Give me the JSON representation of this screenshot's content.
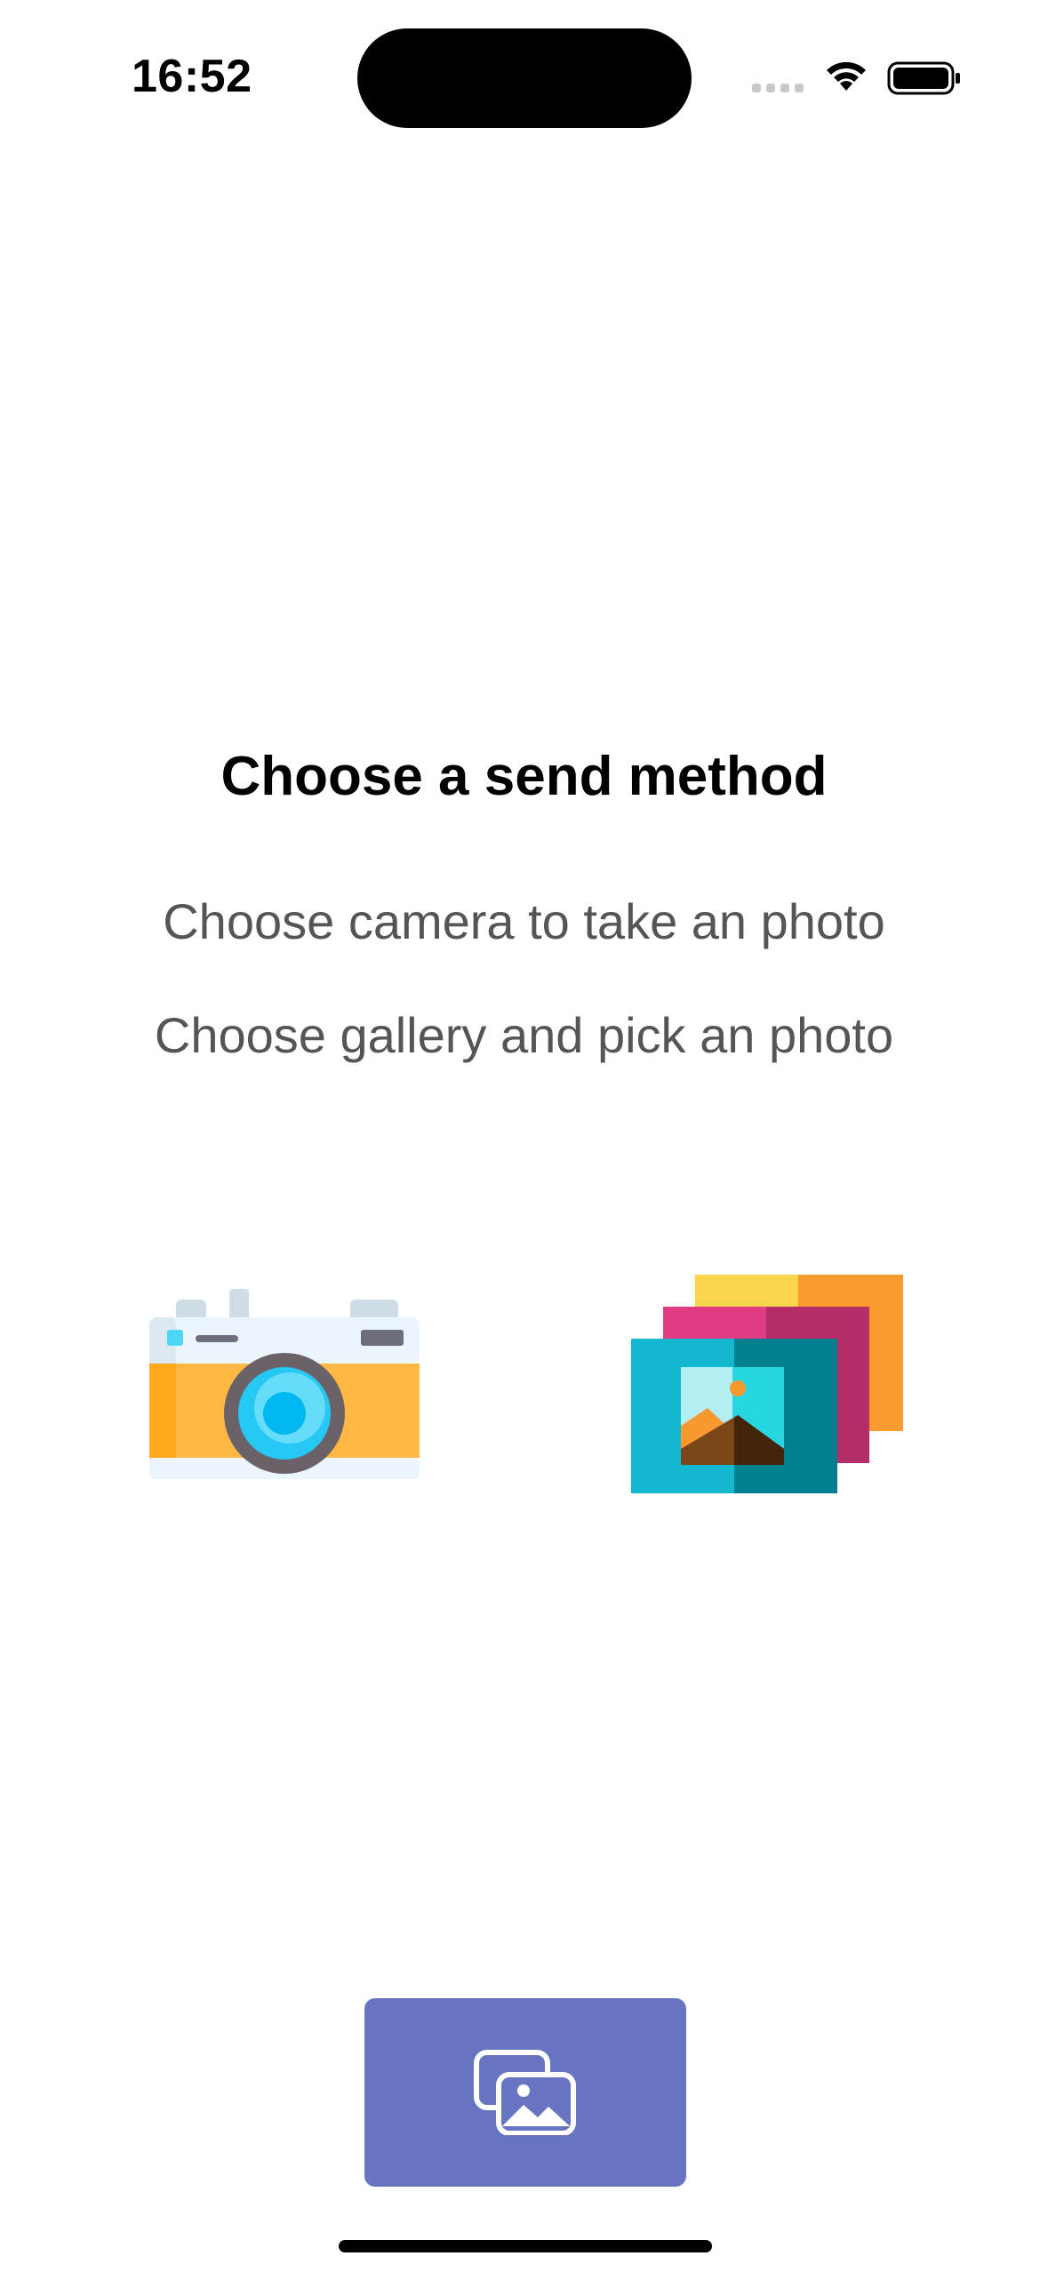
{
  "status_bar": {
    "time": "16:52",
    "icons": [
      "signal-icon",
      "wifi-icon",
      "battery-icon"
    ]
  },
  "main": {
    "title": "Choose a send method",
    "instructions": [
      "Choose camera to take an photo",
      "Choose gallery and pick an photo"
    ],
    "options": [
      {
        "icon": "camera-icon"
      },
      {
        "icon": "gallery-icon"
      }
    ]
  },
  "bottom": {
    "button_icon": "photo-gallery-icon",
    "button_color": "#6674c2"
  }
}
